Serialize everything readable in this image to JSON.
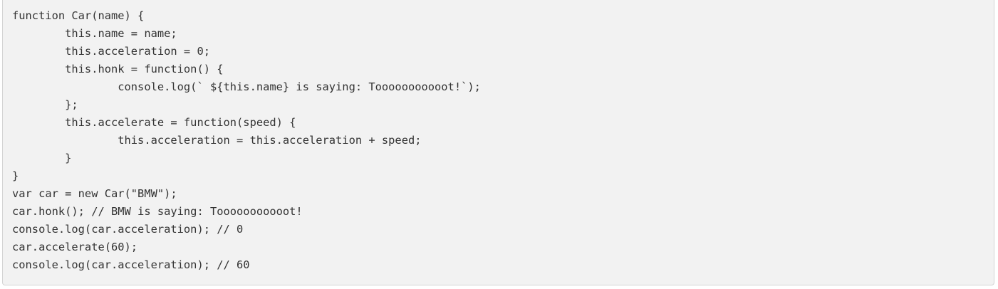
{
  "code": {
    "language": "javascript",
    "lines": [
      "function Car(name) {",
      "        this.name = name;",
      "        this.acceleration = 0;",
      "        this.honk = function() {",
      "                console.log(` ${this.name} is saying: Tooooooooooot!`);",
      "        };",
      "        this.accelerate = function(speed) {",
      "                this.acceleration = this.acceleration + speed;",
      "        }",
      "}",
      "var car = new Car(\"BMW\");",
      "car.honk(); // BMW is saying: Tooooooooooot!",
      "console.log(car.acceleration); // 0",
      "car.accelerate(60);",
      "console.log(car.acceleration); // 60"
    ]
  }
}
